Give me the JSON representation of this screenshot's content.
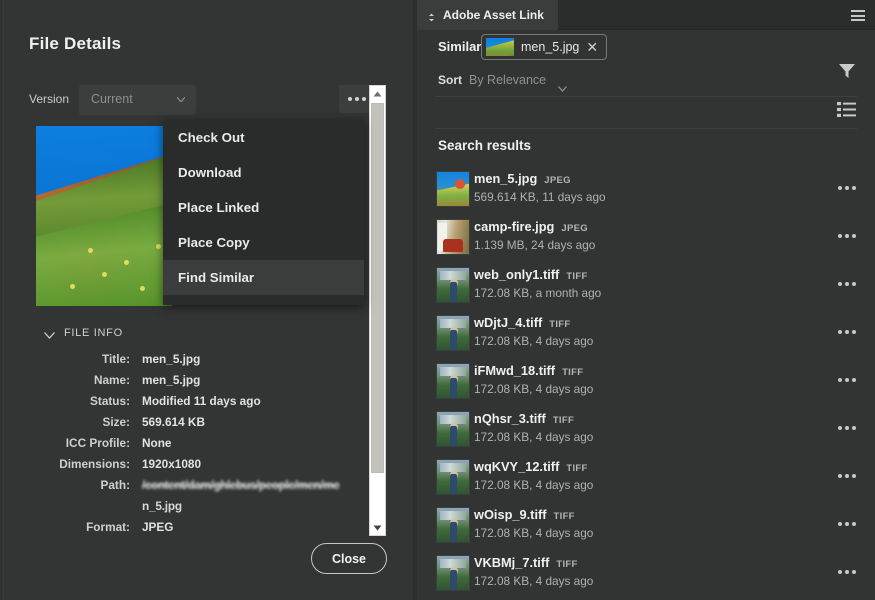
{
  "file_details": {
    "title": "File Details",
    "version": {
      "label": "Version",
      "value": "Current",
      "caret_icon": "chevron-down-icon"
    },
    "overflow_button_icon": "ellipsis-icon",
    "thumbnail_alt": "men_5.jpg preview",
    "file_info": {
      "section_label": "FILE INFO",
      "collapse_icon": "chevron-down-icon",
      "rows": [
        {
          "key": "Title:",
          "value": "men_5.jpg"
        },
        {
          "key": "Name:",
          "value": "men_5.jpg"
        },
        {
          "key": "Status:",
          "value": "Modified 11 days ago"
        },
        {
          "key": "Size:",
          "value": "569.614 KB"
        },
        {
          "key": "ICC Profile:",
          "value": "None"
        },
        {
          "key": "Dimensions:",
          "value": "1920x1080"
        },
        {
          "key": "Path:",
          "value": "/content/dam/ghlebus/people/men/me"
        },
        {
          "key": "",
          "value": "n_5.jpg"
        },
        {
          "key": "Format:",
          "value": "JPEG"
        }
      ]
    },
    "close_button": "Close",
    "scrollbar": {
      "up_icon": "triangle-up-icon",
      "down_icon": "triangle-down-icon"
    }
  },
  "context_menu": {
    "items": [
      {
        "label": "Check Out",
        "active": false
      },
      {
        "label": "Download",
        "active": false
      },
      {
        "label": "Place Linked",
        "active": false
      },
      {
        "label": "Place Copy",
        "active": false
      },
      {
        "label": "Find Similar",
        "active": true
      }
    ]
  },
  "asset_link": {
    "tab": {
      "label": "Adobe Asset Link",
      "drag_icon": "diamond-handle-icon"
    },
    "panel_menu_icon": "hamburger-menu-icon",
    "similar": {
      "label": "Similar",
      "chip_label": "men_5.jpg",
      "chip_remove_icon": "close-icon"
    },
    "sort": {
      "label": "Sort",
      "value": "By Relevance",
      "caret_icon": "chevron-down-icon"
    },
    "filter_icon": "filter-funnel-icon",
    "list_view_icon": "list-view-icon",
    "results_title": "Search results",
    "results": [
      {
        "name": "men_5.jpg",
        "format": "JPEG",
        "meta": "569.614 KB, 11 days ago",
        "thumb": "landscape-flowers",
        "menu_icon": "ellipsis-icon"
      },
      {
        "name": "camp-fire.jpg",
        "format": "JPEG",
        "meta": "1.139 MB, 24 days ago",
        "thumb": "camp-fire",
        "menu_icon": "ellipsis-icon"
      },
      {
        "name": "web_only1.tiff",
        "format": "TIFF",
        "meta": "172.08 KB, a month ago",
        "thumb": "person-field",
        "menu_icon": "ellipsis-icon"
      },
      {
        "name": "wDjtJ_4.tiff",
        "format": "TIFF",
        "meta": "172.08 KB, 4 days ago",
        "thumb": "person-field",
        "menu_icon": "ellipsis-icon"
      },
      {
        "name": "iFMwd_18.tiff",
        "format": "TIFF",
        "meta": "172.08 KB, 4 days ago",
        "thumb": "person-field",
        "menu_icon": "ellipsis-icon"
      },
      {
        "name": "nQhsr_3.tiff",
        "format": "TIFF",
        "meta": "172.08 KB, 4 days ago",
        "thumb": "person-field",
        "menu_icon": "ellipsis-icon"
      },
      {
        "name": "wqKVY_12.tiff",
        "format": "TIFF",
        "meta": "172.08 KB, 4 days ago",
        "thumb": "person-field",
        "menu_icon": "ellipsis-icon"
      },
      {
        "name": "wOisp_9.tiff",
        "format": "TIFF",
        "meta": "172.08 KB, 4 days ago",
        "thumb": "person-field",
        "menu_icon": "ellipsis-icon"
      },
      {
        "name": "VKBMj_7.tiff",
        "format": "TIFF",
        "meta": "172.08 KB, 4 days ago",
        "thumb": "person-field",
        "menu_icon": "ellipsis-icon"
      }
    ]
  },
  "colors": {
    "panel_bg": "#333535",
    "panel_bg_right": "#323434",
    "menu_bg": "#2a2c2c",
    "menu_active": "#3b3d3d",
    "text_primary": "#f0f0f0",
    "text_secondary": "#b0b2b2",
    "scrollbar_thumb": "#c3c1bb"
  }
}
